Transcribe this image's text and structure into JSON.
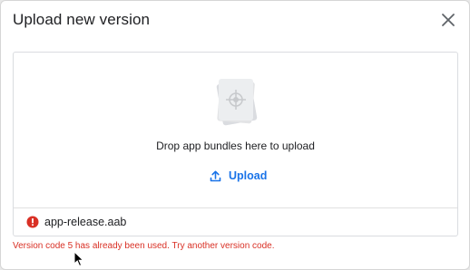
{
  "dialog": {
    "title": "Upload new version",
    "close_icon": "close-icon"
  },
  "dropzone": {
    "graphic_icon": "app-bundle-icon",
    "instruction": "Drop app bundles here to upload",
    "upload_label": "Upload",
    "upload_icon": "upload-icon"
  },
  "file": {
    "name": "app-release.aab",
    "status_icon": "error-icon",
    "status_color": "#d93025"
  },
  "error": {
    "message": "Version code 5 has already been used. Try another version code."
  },
  "colors": {
    "accent": "#1a73e8",
    "error": "#d93025",
    "text": "#202124"
  }
}
